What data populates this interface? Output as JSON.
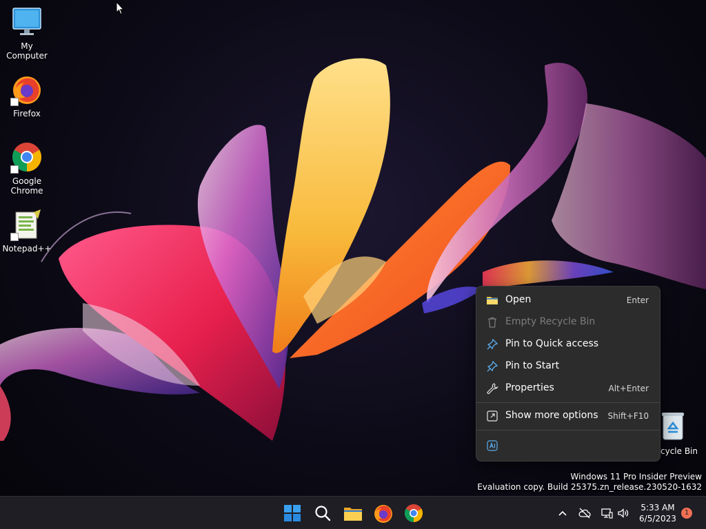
{
  "desktop_icons": [
    {
      "label": "My Computer",
      "icon": "computer-icon",
      "shortcut": false
    },
    {
      "label": "Firefox",
      "icon": "firefox-icon",
      "shortcut": true
    },
    {
      "label": "Google Chrome",
      "icon": "chrome-icon",
      "shortcut": true
    },
    {
      "label": "Notepad++",
      "icon": "notepadpp-icon",
      "shortcut": true
    }
  ],
  "recycle_bin": {
    "label": "cycle Bin",
    "icon": "recycle-bin-icon"
  },
  "context_menu": {
    "items": [
      {
        "label": "Open",
        "shortcut": "Enter",
        "icon": "folder-icon",
        "enabled": true
      },
      {
        "label": "Empty Recycle Bin",
        "shortcut": "",
        "icon": "trash-icon",
        "enabled": false
      },
      {
        "label": "Pin to Quick access",
        "shortcut": "",
        "icon": "pin-icon",
        "enabled": true
      },
      {
        "label": "Pin to Start",
        "shortcut": "",
        "icon": "pin-icon",
        "enabled": true
      },
      {
        "label": "Properties",
        "shortcut": "Alt+Enter",
        "icon": "wrench-icon",
        "enabled": true
      }
    ],
    "more_options": {
      "label": "Show more options",
      "shortcut": "Shift+F10",
      "icon": "more-options-icon"
    },
    "bottom_icon": "ai-rewrite-icon"
  },
  "watermark": {
    "line1": "Windows 11 Pro Insider Preview",
    "line2": "Evaluation copy. Build 25375.zn_release.230520-1632"
  },
  "taskbar": {
    "apps": [
      "start-icon",
      "search-icon",
      "file-explorer-icon",
      "firefox-icon",
      "chrome-icon"
    ],
    "tray": [
      "chevron-up-icon",
      "cloud-off-icon",
      "network-icon",
      "volume-icon"
    ],
    "time": "5:33 AM",
    "date": "6/5/2023",
    "notification_count": "1"
  },
  "colors": {
    "menu_bg": "#2c2c2c",
    "taskbar_bg": "#1e1e24",
    "accent": "#0078d4",
    "badge": "#f06f53"
  }
}
